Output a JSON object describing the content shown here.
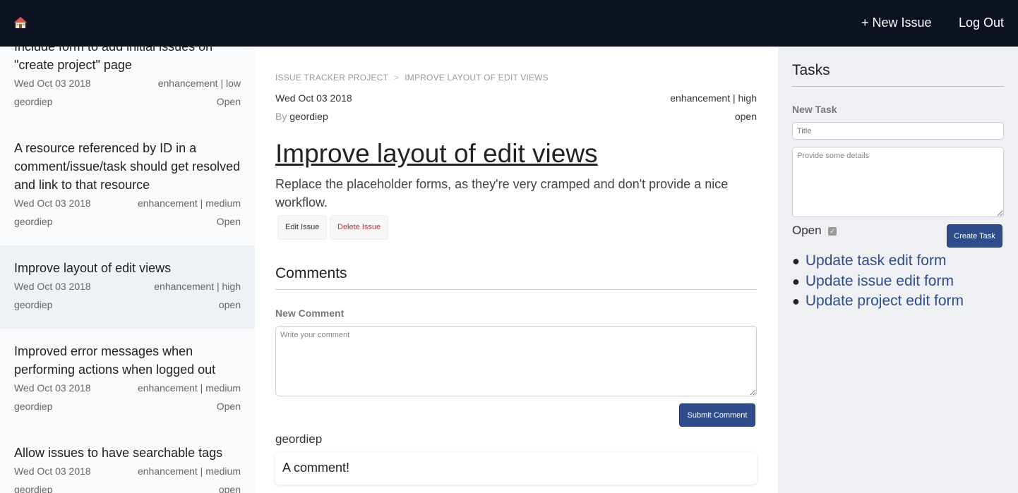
{
  "topbar": {
    "home_icon": "house-icon",
    "new_issue_label": "+ New Issue",
    "logout_label": "Log Out"
  },
  "sidebar": {
    "items": [
      {
        "title_line1": "Include form to add initial issues on",
        "title_line2": "\"create project\" page",
        "date": "Wed Oct 03 2018",
        "tags": "enhancement | low",
        "author": "geordiep",
        "status": "Open"
      },
      {
        "title": "A resource referenced by ID in a comment/issue/task should get resolved and link to that resource",
        "date": "Wed Oct 03 2018",
        "tags": "enhancement | medium",
        "author": "geordiep",
        "status": "Open"
      },
      {
        "title": "Improve layout of edit views",
        "date": "Wed Oct 03 2018",
        "tags": "enhancement | high",
        "author": "geordiep",
        "status": "open"
      },
      {
        "title": "Improved error messages when performing actions when logged out",
        "date": "Wed Oct 03 2018",
        "tags": "enhancement | medium",
        "author": "geordiep",
        "status": "Open"
      },
      {
        "title": "Allow issues to have searchable tags",
        "date": "Wed Oct 03 2018",
        "tags": "enhancement | medium",
        "author": "geordiep",
        "status": "open"
      }
    ]
  },
  "main": {
    "breadcrumb": {
      "project": "ISSUE TRACKER PROJECT",
      "separator": ">",
      "issue": "IMPROVE LAYOUT OF EDIT VIEWS"
    },
    "date": "Wed Oct 03 2018",
    "tags": "enhancement | high",
    "by_label": "By",
    "author": "geordiep",
    "status": "open",
    "title": "Improve layout of edit views",
    "description": "Replace the placeholder forms, as they're very cramped and don't provide a nice workflow.",
    "edit_label": "Edit Issue",
    "delete_label": "Delete Issue",
    "comments_title": "Comments",
    "new_comment_label": "New Comment",
    "comment_placeholder": "Write your comment",
    "submit_label": "Submit Comment",
    "comments": [
      {
        "author": "geordiep",
        "text": "A comment!"
      }
    ]
  },
  "tasks": {
    "title": "Tasks",
    "new_task_label": "New Task",
    "title_placeholder": "Title",
    "details_placeholder": "Provide some details",
    "open_label": "Open",
    "open_checked": true,
    "create_label": "Create Task",
    "items": [
      "Update task edit form",
      "Update issue edit form",
      "Update project edit form"
    ]
  },
  "colors": {
    "topbar": "#0d1220",
    "primary": "#2f4d8a",
    "danger": "#b13a3a",
    "tasks_bg": "#eef0f4",
    "sidebar_active": "#eef1f5"
  }
}
